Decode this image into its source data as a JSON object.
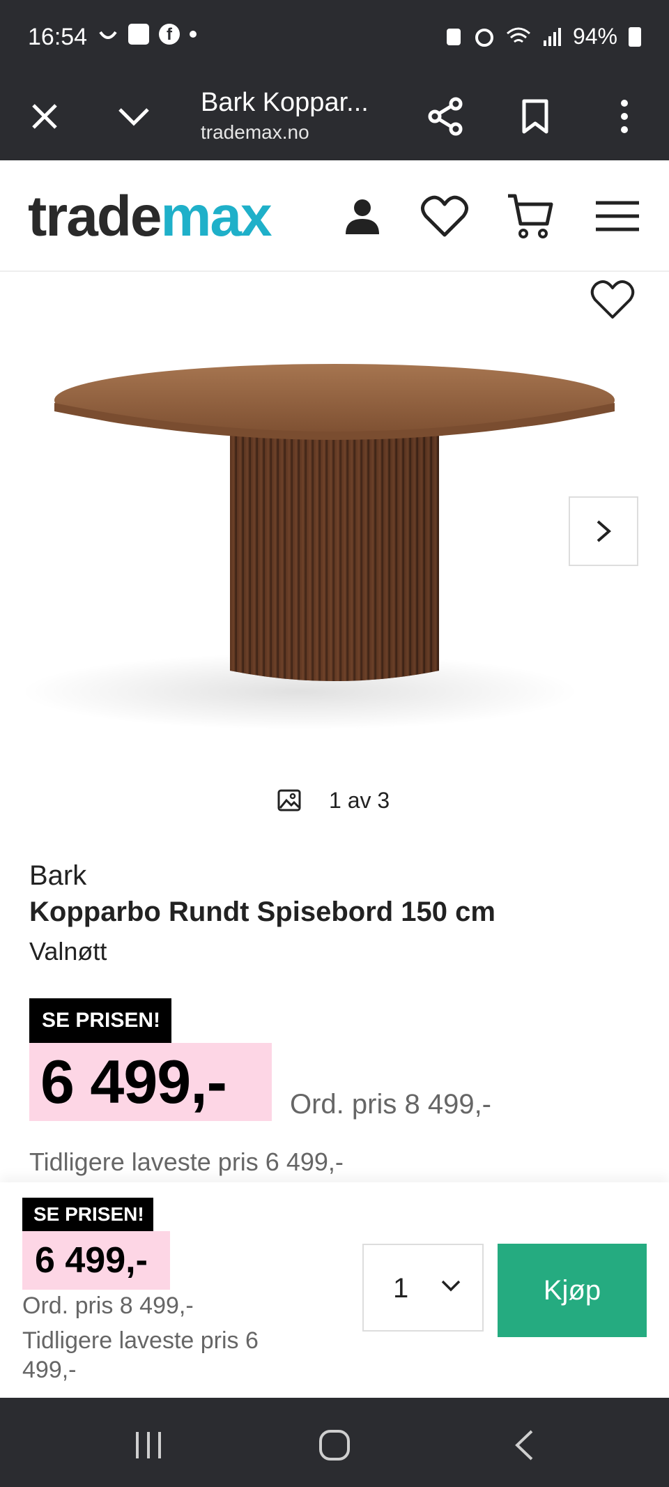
{
  "status_bar": {
    "time": "16:54",
    "battery": "94%",
    "icons": [
      "smile-icon",
      "key-icon",
      "facebook-icon",
      "dot-icon",
      "battery-saver-icon",
      "alarm-icon",
      "wifi-icon",
      "signal-icon",
      "battery-icon"
    ]
  },
  "browser": {
    "title": "Bark Koppar...",
    "url": "trademax.no"
  },
  "site": {
    "logo_part1": "trade",
    "logo_part2": "max",
    "logo_color": "#1fb0c9"
  },
  "gallery": {
    "counter": "1 av 3"
  },
  "product": {
    "brand": "Bark",
    "name": "Kopparbo Rundt Spisebord 150 cm",
    "variant": "Valnøtt",
    "badge": "SE PRISEN!",
    "price": "6 499,-",
    "ordinary_price": "Ord. pris 8 499,-",
    "lowest_price": "Tidligere laveste pris 6 499,-"
  },
  "sticky_bar": {
    "badge": "SE PRISEN!",
    "price": "6 499,-",
    "ordinary_price": "Ord. pris 8 499,-",
    "lowest_price": "Tidligere laveste pris 6 499,-",
    "quantity": "1",
    "buy_label": "Kjøp",
    "buy_color": "#25ab80"
  }
}
